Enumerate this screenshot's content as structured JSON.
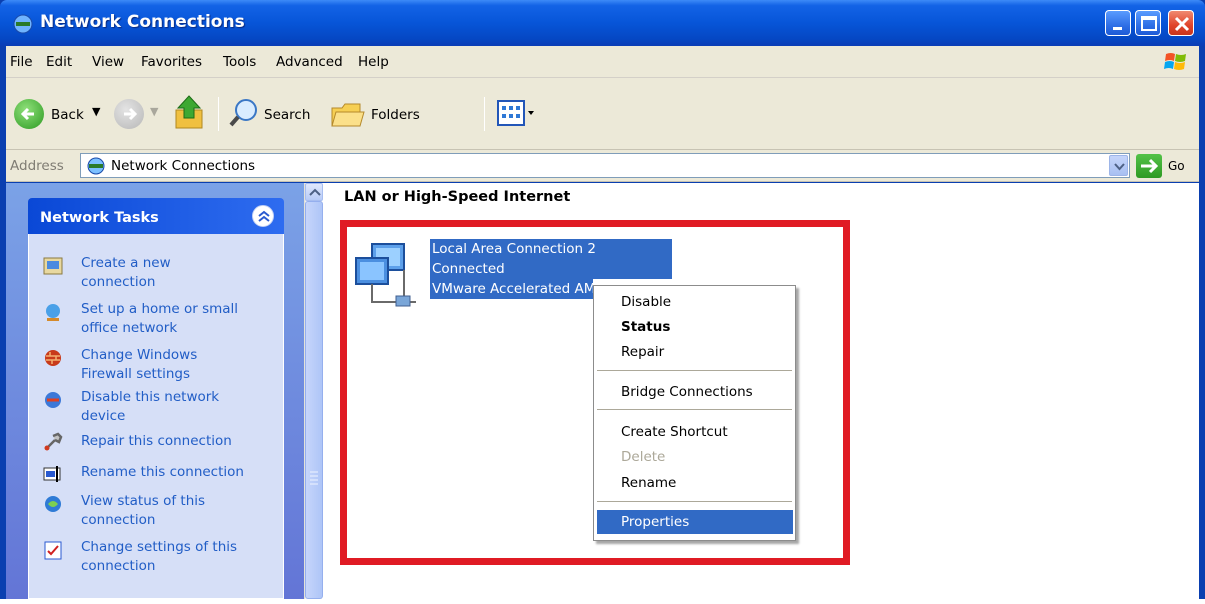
{
  "window": {
    "title": "Network Connections"
  },
  "menubar": {
    "items": [
      "File",
      "Edit",
      "View",
      "Favorites",
      "Tools",
      "Advanced",
      "Help"
    ]
  },
  "toolbar": {
    "back_label": "Back",
    "search_label": "Search",
    "folders_label": "Folders"
  },
  "address": {
    "label": "Address",
    "value": "Network Connections",
    "go_label": "Go"
  },
  "taskpane": {
    "title": "Network Tasks",
    "tasks": [
      {
        "line1": "Create a new",
        "line2": "connection",
        "icon": "new-connection-icon"
      },
      {
        "line1": "Set up a home or small",
        "line2": "office network",
        "icon": "home-network-icon"
      },
      {
        "line1": "Change Windows",
        "line2": "Firewall settings",
        "icon": "firewall-icon"
      },
      {
        "line1": "Disable this network",
        "line2": "device",
        "icon": "disable-network-icon"
      },
      {
        "line1": "Repair this connection",
        "line2": "",
        "icon": "repair-icon"
      },
      {
        "line1": "Rename this connection",
        "line2": "",
        "icon": "rename-icon"
      },
      {
        "line1": "View status of this",
        "line2": "connection",
        "icon": "status-icon"
      },
      {
        "line1": "Change settings of this",
        "line2": "connection",
        "icon": "settings-icon"
      }
    ]
  },
  "main": {
    "group_title": "LAN or High-Speed Internet",
    "connection": {
      "name": "Local Area Connection 2",
      "status": "Connected",
      "device": "VMware Accelerated AMD PCNet"
    }
  },
  "context_menu": {
    "items": [
      {
        "label": "Disable",
        "bold": false,
        "disabled": false
      },
      {
        "label": "Status",
        "bold": true,
        "disabled": false
      },
      {
        "label": "Repair",
        "bold": false,
        "disabled": false
      },
      {
        "label": "Bridge Connections",
        "bold": false,
        "disabled": false
      },
      {
        "label": "Create Shortcut",
        "bold": false,
        "disabled": false
      },
      {
        "label": "Delete",
        "bold": false,
        "disabled": true
      },
      {
        "label": "Rename",
        "bold": false,
        "disabled": false
      },
      {
        "label": "Properties",
        "bold": false,
        "disabled": false,
        "highlighted": true
      }
    ]
  },
  "colors": {
    "titlebar": "#0755d8",
    "selection": "#316ac5",
    "annotation_box": "#e01b24",
    "task_link": "#215dc6"
  }
}
